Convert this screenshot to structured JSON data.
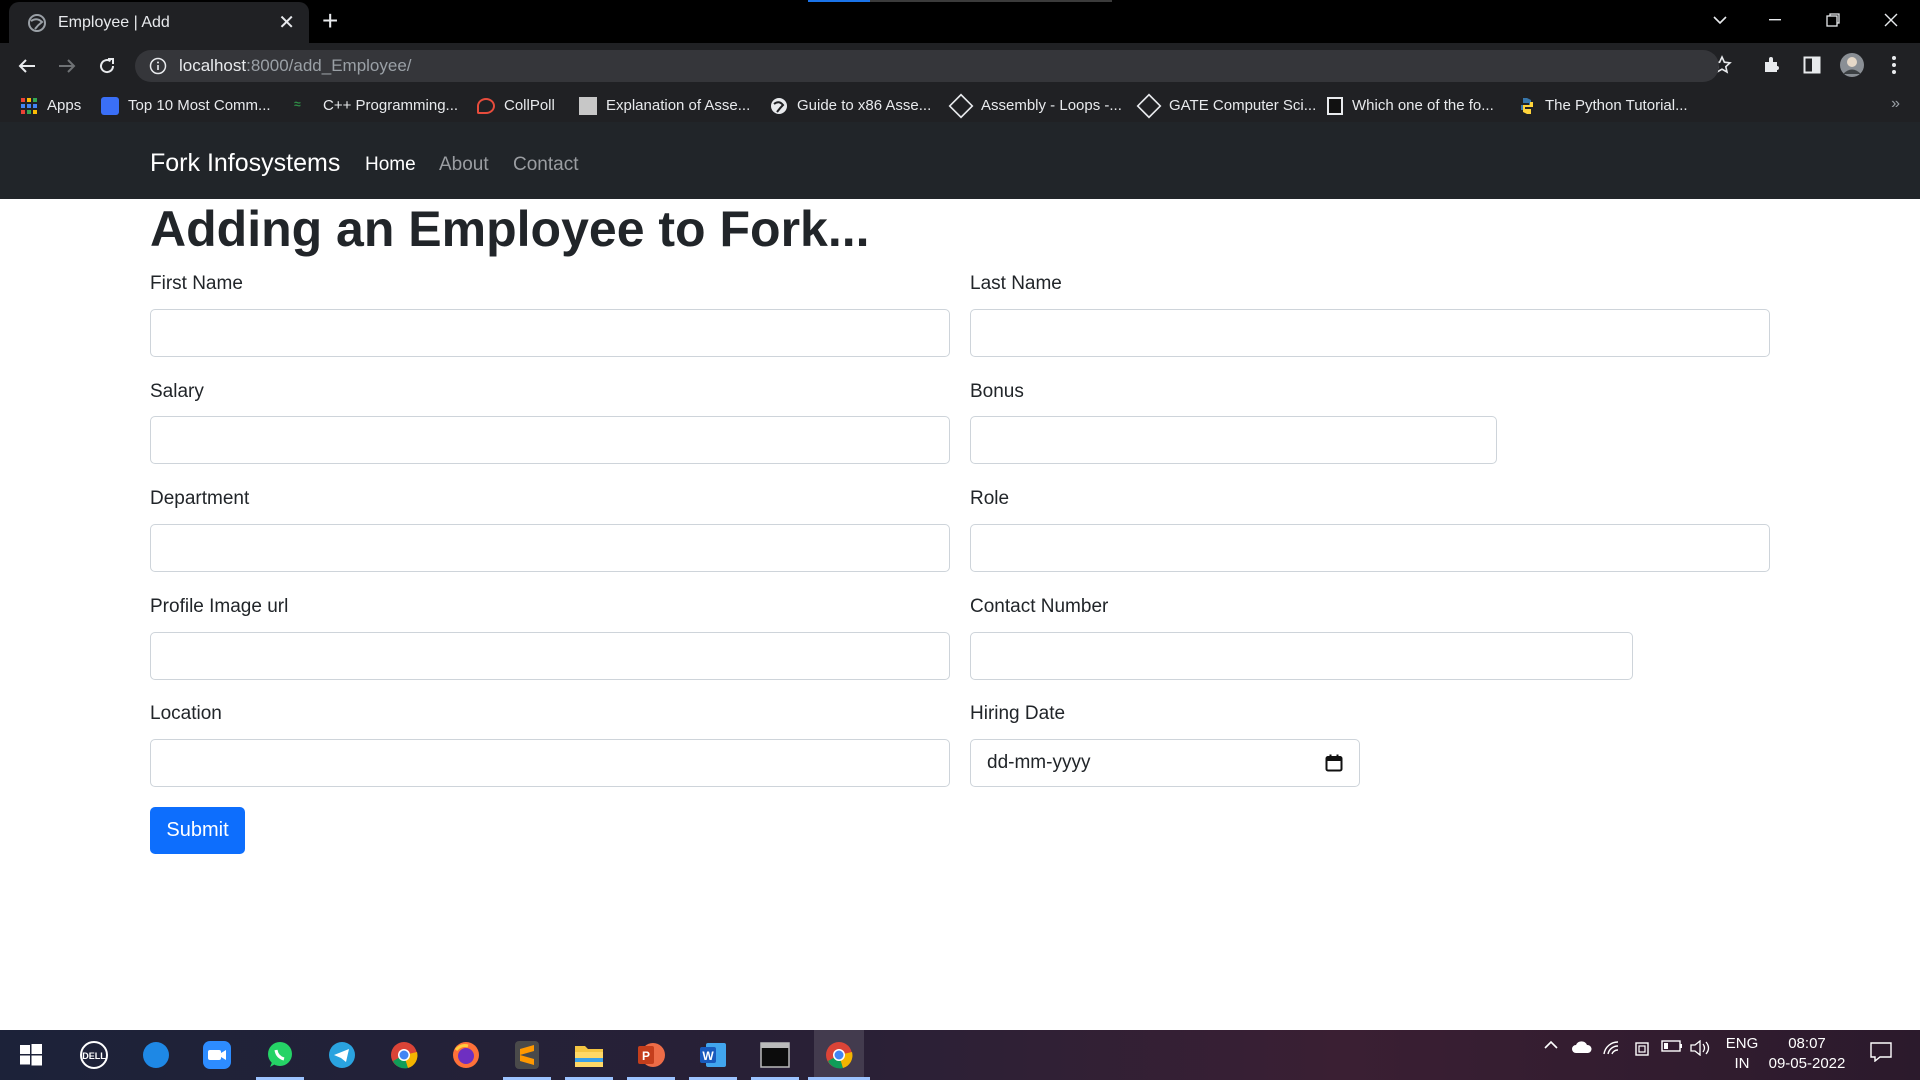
{
  "browser": {
    "tab_title": "Employee | Add",
    "url_host": "localhost",
    "url_path": ":8000/add_Employee/",
    "bookmarks": [
      {
        "label": "Apps",
        "icon": "apps-grid-icon"
      },
      {
        "label": "Top 10 Most Comm...",
        "icon": "bookmark-site-icon"
      },
      {
        "label": "C++ Programming...",
        "icon": "geeksforgeeks-icon"
      },
      {
        "label": "CollPoll",
        "icon": "collpoll-icon"
      },
      {
        "label": "Explanation of Asse...",
        "icon": "site-icon"
      },
      {
        "label": "Guide to x86 Asse...",
        "icon": "globe-icon"
      },
      {
        "label": "Assembly - Loops -...",
        "icon": "site-icon"
      },
      {
        "label": "GATE Computer Sci...",
        "icon": "site-icon"
      },
      {
        "label": "Which one of the fo...",
        "icon": "site-icon"
      },
      {
        "label": "The Python Tutorial...",
        "icon": "python-icon"
      }
    ]
  },
  "navbar": {
    "brand": "Fork Infosystems",
    "links": [
      "Home",
      "About",
      "Contact"
    ]
  },
  "form": {
    "title": "Adding an Employee to Fork...",
    "labels": {
      "first_name": "First Name",
      "last_name": "Last Name",
      "salary": "Salary",
      "bonus": "Bonus",
      "department": "Department",
      "role": "Role",
      "profile_image": "Profile Image url",
      "contact": "Contact Number",
      "location": "Location",
      "hiring_date": "Hiring Date"
    },
    "hiring_date_placeholder": "dd-mm-yyyy",
    "submit": "Submit"
  },
  "taskbar": {
    "lang": "ENG",
    "region": "IN",
    "time": "08:07",
    "date": "09-05-2022"
  },
  "colors": {
    "navbar_bg": "#212529",
    "primary": "#0d6efd",
    "chrome_bg": "#202124"
  }
}
